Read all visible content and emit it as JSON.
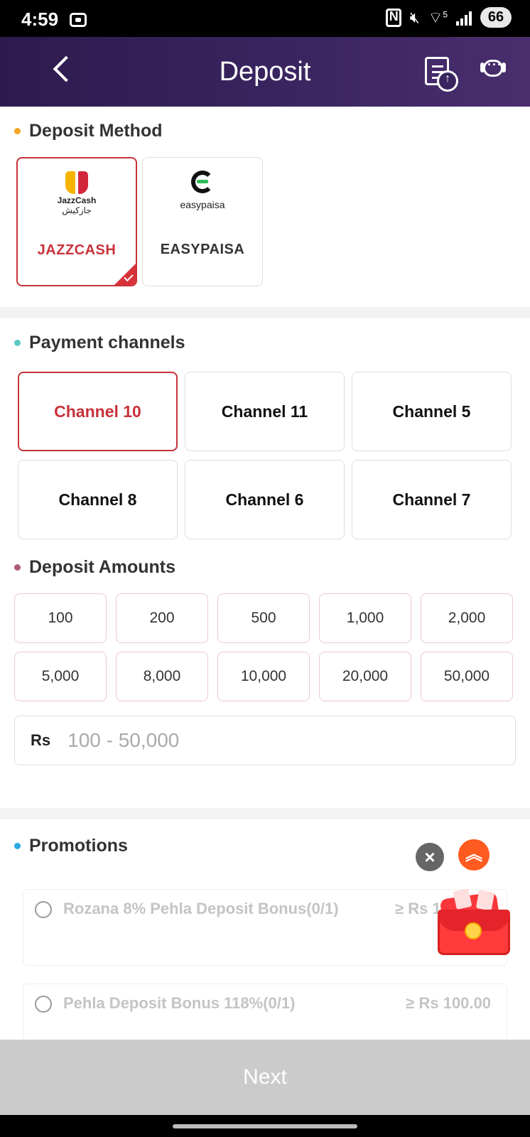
{
  "status_bar": {
    "time": "4:59",
    "battery": "66",
    "wifi_label": "5"
  },
  "header": {
    "title": "Deposit"
  },
  "deposit_method": {
    "title": "Deposit Method",
    "dot_color": "#f5a623",
    "methods": [
      {
        "label": "JAZZCASH",
        "logo_name": "JazzCash",
        "logo_subtitle": "جازکیش",
        "selected": true
      },
      {
        "label": "EASYPAISA",
        "logo_name": "easypaisa",
        "selected": false
      }
    ]
  },
  "payment_channels": {
    "title": "Payment channels",
    "dot_color": "#5cc8c1",
    "channels": [
      {
        "label": "Channel 10",
        "selected": true
      },
      {
        "label": "Channel 11",
        "selected": false
      },
      {
        "label": "Channel 5",
        "selected": false
      },
      {
        "label": "Channel 8",
        "selected": false
      },
      {
        "label": "Channel 6",
        "selected": false
      },
      {
        "label": "Channel 7",
        "selected": false
      }
    ]
  },
  "deposit_amounts": {
    "title": "Deposit Amounts",
    "dot_color": "#b05a7a",
    "amounts": [
      "100",
      "200",
      "500",
      "1,000",
      "2,000",
      "5,000",
      "8,000",
      "10,000",
      "20,000",
      "50,000"
    ],
    "input_prefix": "Rs",
    "input_placeholder": "100 - 50,000"
  },
  "promotions": {
    "title": "Promotions",
    "dot_color": "#2aa9e0",
    "items": [
      {
        "title": "Rozana 8% Pehla Deposit Bonus(0/1)",
        "min": "≥ Rs 10"
      },
      {
        "title": "Pehla Deposit Bonus 118%(0/1)",
        "min": "≥ Rs 100.00"
      }
    ]
  },
  "next_button": {
    "label": "Next"
  },
  "colors": {
    "accent": "#c8323a",
    "header_bg": "#3a2560",
    "next_disabled": "#cbcbcb"
  }
}
